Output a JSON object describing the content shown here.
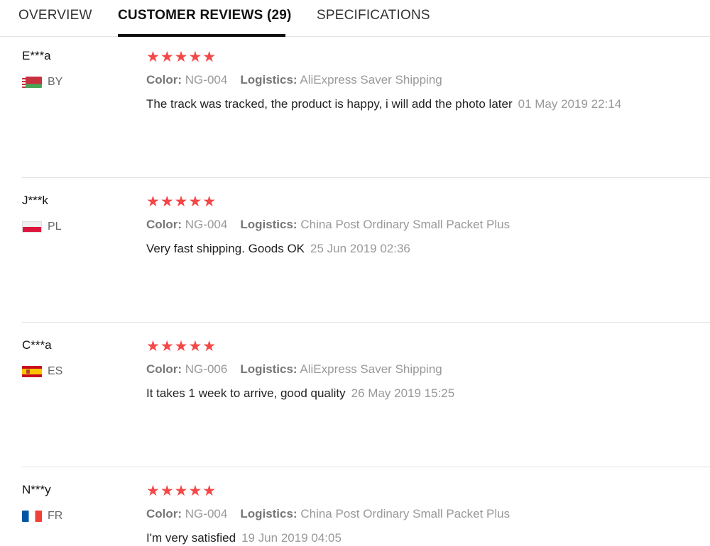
{
  "tabs": {
    "overview": "OVERVIEW",
    "reviews": "CUSTOMER REVIEWS (29)",
    "specifications": "SPECIFICATIONS",
    "active": "reviews"
  },
  "labels": {
    "color": "Color:",
    "logistics": "Logistics:"
  },
  "colors": {
    "star": "#f44747",
    "active_tab_underline": "#111111"
  },
  "reviews": [
    {
      "user": "E***a",
      "country": "BY",
      "flag": "belarus-flag",
      "rating": 5,
      "stars": "★★★★★",
      "color_value": "NG-004",
      "logistics_value": "AliExpress Saver Shipping",
      "text": "The track was tracked, the product is happy, i will add the photo later",
      "date": "01 May 2019 22:14"
    },
    {
      "user": "J***k",
      "country": "PL",
      "flag": "poland-flag",
      "rating": 5,
      "stars": "★★★★★",
      "color_value": "NG-004",
      "logistics_value": "China Post Ordinary Small Packet Plus",
      "text": "Very fast shipping. Goods OK",
      "date": "25 Jun 2019 02:36"
    },
    {
      "user": "C***a",
      "country": "ES",
      "flag": "spain-flag",
      "rating": 5,
      "stars": "★★★★★",
      "color_value": "NG-006",
      "logistics_value": "AliExpress Saver Shipping",
      "text": "It takes 1 week to arrive, good quality",
      "date": "26 May 2019 15:25"
    },
    {
      "user": "N***y",
      "country": "FR",
      "flag": "france-flag",
      "rating": 5,
      "stars": "★★★★★",
      "color_value": "NG-004",
      "logistics_value": "China Post Ordinary Small Packet Plus",
      "text": "I'm very satisfied",
      "date": "19 Jun 2019 04:05"
    }
  ]
}
